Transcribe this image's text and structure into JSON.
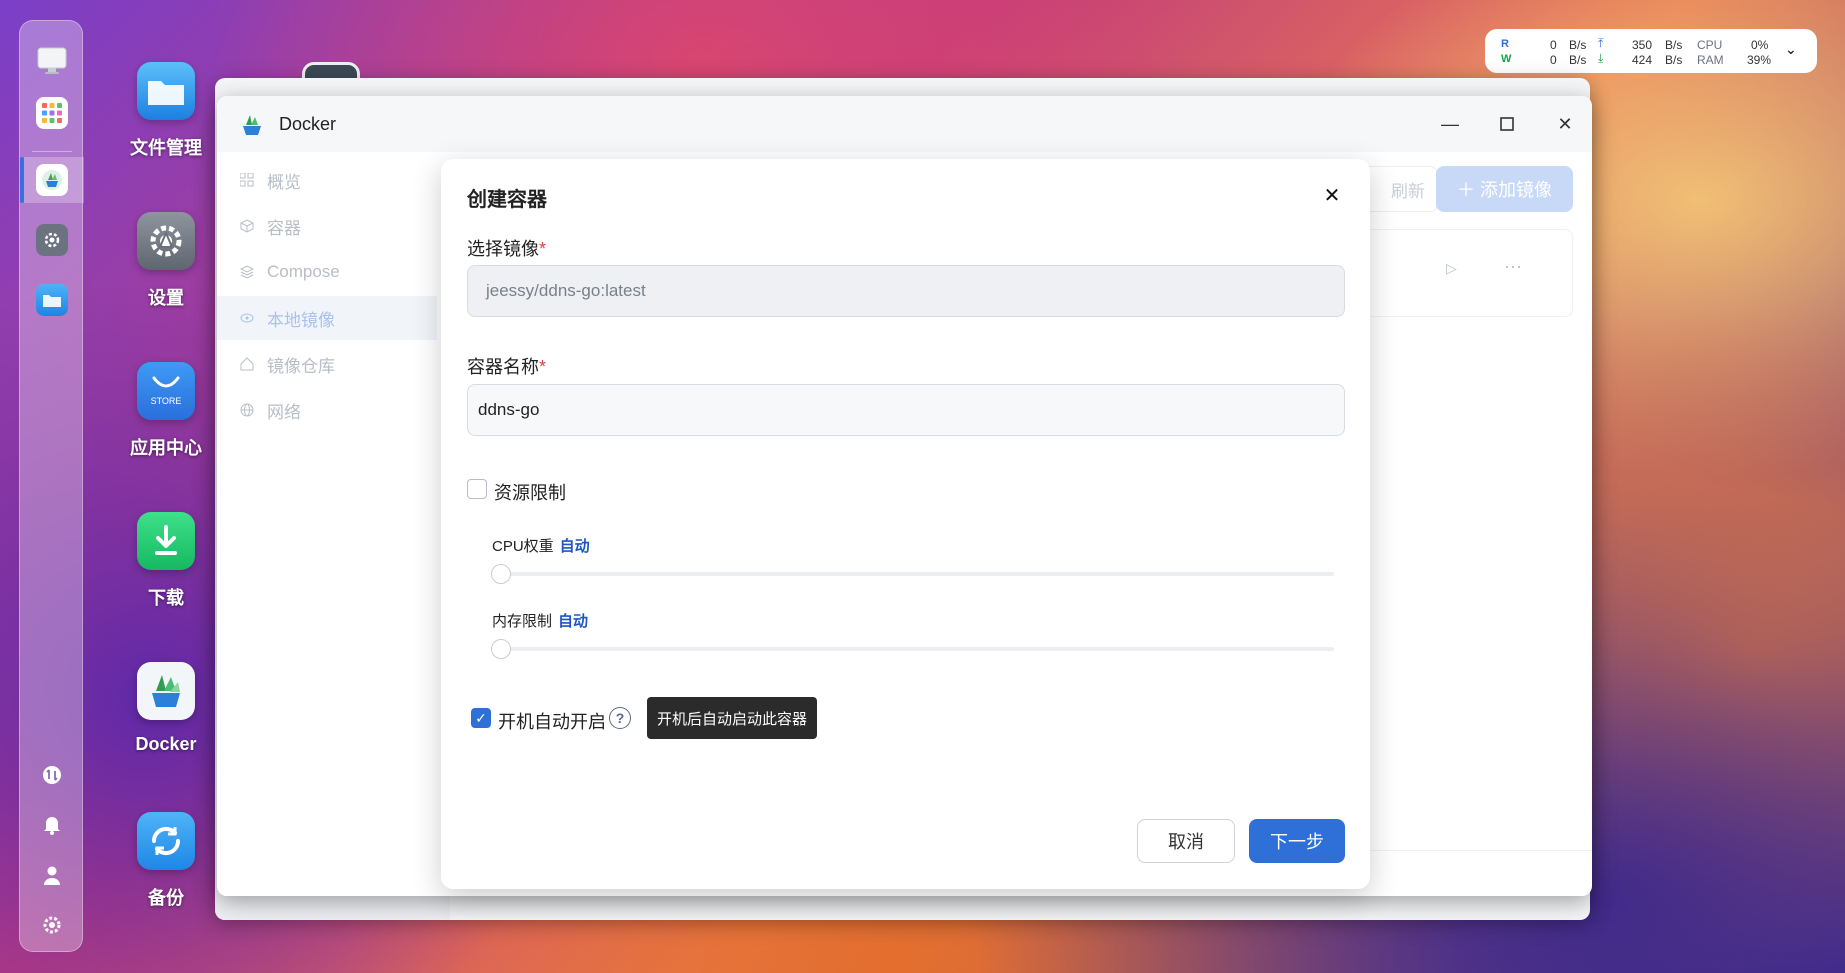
{
  "dock": {
    "items": [
      "monitor",
      "apps",
      "docker",
      "settings",
      "files"
    ],
    "bottom_items": [
      "transfer",
      "notifications",
      "user",
      "preferences"
    ]
  },
  "desktop": {
    "icons": [
      {
        "name": "files",
        "label": "文件管理"
      },
      {
        "name": "settings",
        "label": "设置"
      },
      {
        "name": "store",
        "label": "应用中心",
        "badge": "STORE"
      },
      {
        "name": "download",
        "label": "下载"
      },
      {
        "name": "docker",
        "label": "Docker"
      },
      {
        "name": "backup",
        "label": "备份"
      }
    ]
  },
  "status": {
    "r_label": "R",
    "w_label": "W",
    "r_value": "0",
    "w_value": "0",
    "r_unit": "B/s",
    "w_unit": "B/s",
    "up_value": "350",
    "down_value": "424",
    "up_unit": "B/s",
    "down_unit": "B/s",
    "cpu_label": "CPU",
    "ram_label": "RAM",
    "cpu_value": "0%",
    "ram_value": "39%"
  },
  "window": {
    "title": "Docker",
    "sidebar": [
      {
        "label": "概览",
        "icon": "grid-icon"
      },
      {
        "label": "容器",
        "icon": "cube-icon"
      },
      {
        "label": "Compose",
        "icon": "layers-icon"
      },
      {
        "label": "本地镜像",
        "icon": "disk-icon",
        "active": true
      },
      {
        "label": "镜像仓库",
        "icon": "home-icon"
      },
      {
        "label": "网络",
        "icon": "globe-icon"
      }
    ],
    "refresh_label": "刷新",
    "add_image_label": "＋ 添加镜像"
  },
  "modal": {
    "title": "创建容器",
    "image_label": "选择镜像",
    "image_value": "jeessy/ddns-go:latest",
    "name_label": "容器名称",
    "name_value": "ddns-go",
    "resource_limit_label": "资源限制",
    "resource_limit_checked": false,
    "cpu_label": "CPU权重",
    "cpu_value": "自动",
    "memory_label": "内存限制",
    "memory_value": "自动",
    "autostart_label": "开机自动开启",
    "autostart_checked": true,
    "tooltip": "开机后自动启动此容器",
    "cancel_label": "取消",
    "next_label": "下一步",
    "required_mark": "*"
  },
  "colors": {
    "primary": "#2e6fd8",
    "auto_text": "#1d55c4",
    "required": "#e04040"
  }
}
